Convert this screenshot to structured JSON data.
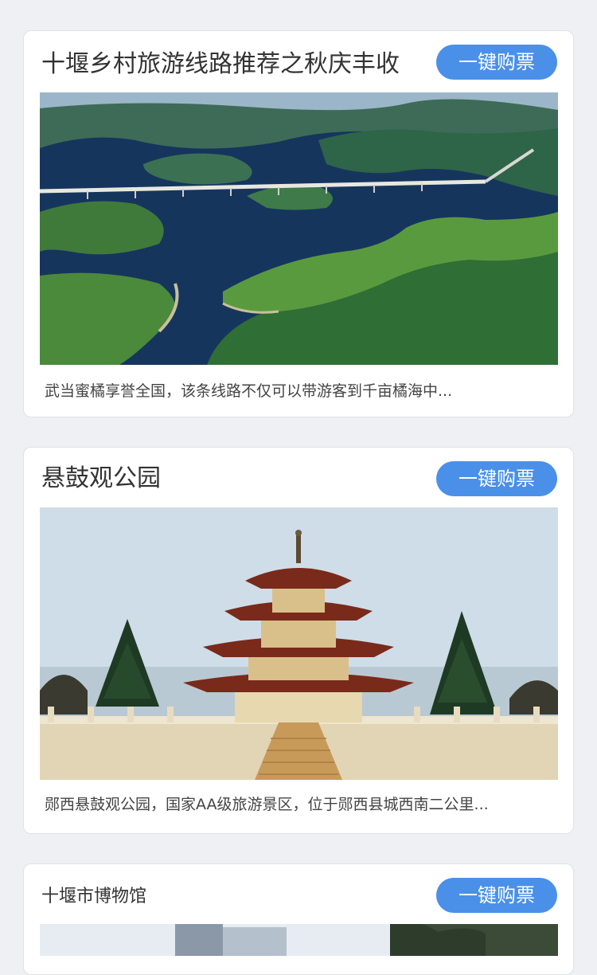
{
  "cards": [
    {
      "title": "十堰乡村旅游线路推荐之秋庆丰收",
      "button_label": "一键购票",
      "image_alt": "lake-islands-bridge-aerial",
      "description": "武当蜜橘享誉全国，该条线路不仅可以带游客到千亩橘海中..."
    },
    {
      "title": "悬鼓观公园",
      "button_label": "一键购票",
      "image_alt": "pagoda-pavilion-park",
      "description": "郧西悬鼓观公园，国家AA级旅游景区，位于郧西县城西南二公里..."
    },
    {
      "title": "十堰市博物馆",
      "button_label": "一键购票",
      "image_alt": "museum-building"
    }
  ],
  "colors": {
    "page_bg": "#eef0f4",
    "card_bg": "#ffffff",
    "button_bg": "#4a90e8",
    "button_text": "#ffffff",
    "title_text": "#333333"
  }
}
